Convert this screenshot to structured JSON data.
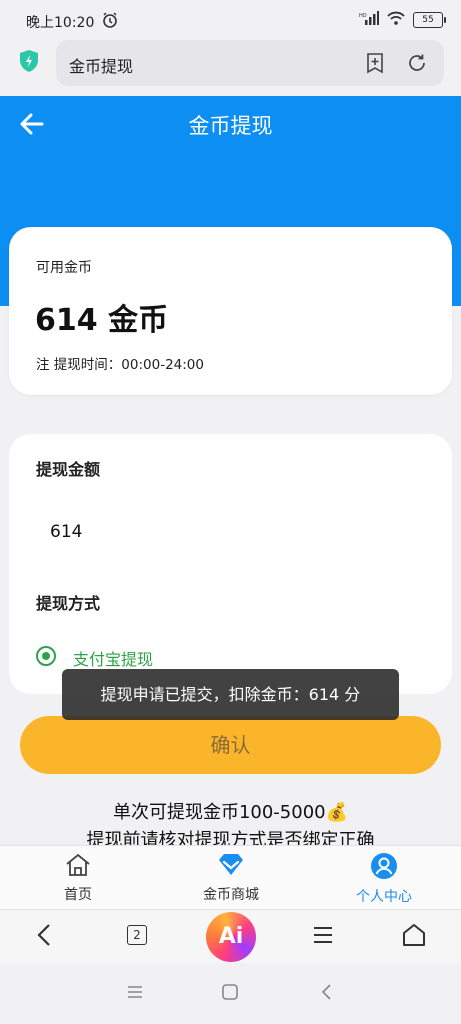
{
  "status_bar": {
    "time": "晚上10:20",
    "battery": "55"
  },
  "browser": {
    "url_title": "金币提现"
  },
  "header": {
    "title": "金币提现"
  },
  "balance_card": {
    "label": "可用金币",
    "amount": "614 金币",
    "note": "注 提现时间：00:00-24:00"
  },
  "withdraw_card": {
    "amount_label": "提现金额",
    "amount_value": "614",
    "method_label": "提现方式",
    "method_option": "支付宝提现"
  },
  "toast": "提现申请已提交，扣除金币：614 分",
  "confirm_label": "确认",
  "tips": [
    "单次可提现金币100-5000💰",
    "提现前请核对提现方式是否绑定正确"
  ],
  "tabbar": {
    "items": [
      {
        "label": "首页",
        "icon": "home-icon"
      },
      {
        "label": "金币商城",
        "icon": "diamond-icon"
      },
      {
        "label": "个人中心",
        "icon": "user-icon",
        "active": true
      }
    ],
    "active_color": "#1a8ef0"
  },
  "browser_bar": {
    "tab_count": "2",
    "ai_label": "Ai"
  },
  "colors": {
    "header_blue": "#0c8ef3",
    "confirm_yellow": "#fbb52b",
    "radio_green": "#2ea34a"
  }
}
